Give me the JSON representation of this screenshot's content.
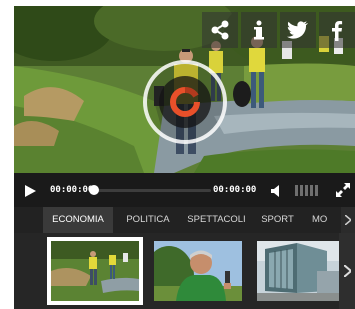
{
  "video": {
    "share_icons": [
      "share-icon",
      "info-icon",
      "twitter-icon",
      "facebook-icon"
    ]
  },
  "controls": {
    "current_time": "00:00:00",
    "duration": "00:00:00",
    "progress_fraction": 0,
    "volume_bars": 5
  },
  "tabs": [
    {
      "label": "ECONOMIA",
      "active": true
    },
    {
      "label": "POLITICA",
      "active": false
    },
    {
      "label": "SPETTACOLI",
      "active": false
    },
    {
      "label": "SPORT",
      "active": false
    },
    {
      "label": "MO",
      "active": false
    }
  ],
  "thumbnails": [
    {
      "subject": "volunteers-riverbank",
      "selected": true
    },
    {
      "subject": "man-green-shirt-interview",
      "selected": false
    },
    {
      "subject": "glass-building",
      "selected": false
    }
  ],
  "colors": {
    "accent": "#e8502a",
    "bar_background": "#1a1a1a",
    "tab_active_background": "#3a3a3a"
  }
}
